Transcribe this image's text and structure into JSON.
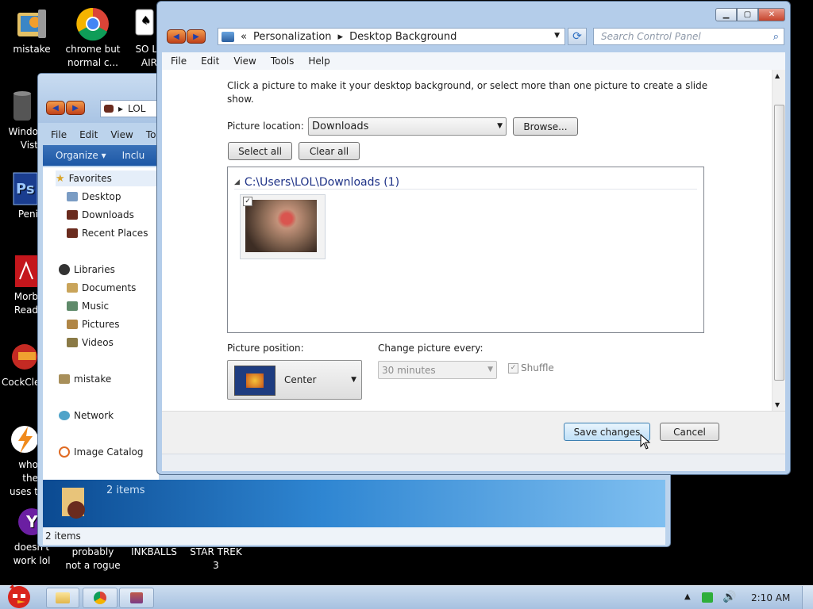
{
  "desktop_icons": [
    {
      "label": "mistake",
      "icon": "flower-folder-icon"
    },
    {
      "label": "chrome but normal c...",
      "icon": "chrome-icon"
    },
    {
      "label": "SO L AIR",
      "icon": "solitaire-icon"
    },
    {
      "label": "Windo Vist",
      "icon": "recycle-bin-icon"
    },
    {
      "label": "Peni",
      "icon": "photoshop-icon"
    },
    {
      "label": "Morb Read",
      "icon": "pdf-reader-icon"
    },
    {
      "label": "CockCle",
      "icon": "ccleaner-icon"
    },
    {
      "label": "who the uses t",
      "icon": "winamp-icon"
    },
    {
      "label": "doesn't work lol",
      "icon": "yahoo-icon"
    },
    {
      "label": "probably not a rogue",
      "icon": "blank-icon"
    },
    {
      "label": "INKBALLS",
      "icon": "blank-icon"
    },
    {
      "label": "STAR TREK 3",
      "icon": "blank-icon"
    }
  ],
  "explorer": {
    "breadcrumb": "LOL",
    "menu": [
      "File",
      "Edit",
      "View",
      "To"
    ],
    "toolbar": {
      "organize": "Organize ▾",
      "include": "Inclu"
    },
    "nav": {
      "favorites": "Favorites",
      "desktop": "Desktop",
      "downloads": "Downloads",
      "recent": "Recent Places",
      "libraries": "Libraries",
      "documents": "Documents",
      "music": "Music",
      "pictures": "Pictures",
      "videos": "Videos",
      "homegroup": "mistake",
      "network": "Network",
      "catalog": "Image Catalog"
    },
    "detail_count": "2 items",
    "status": "2 items"
  },
  "cpanel": {
    "address": {
      "sep": "«",
      "crumb1": "Personalization",
      "arrow": "▸",
      "crumb2": "Desktop Background"
    },
    "search_placeholder": "Search Control Panel",
    "menu": [
      "File",
      "Edit",
      "View",
      "Tools",
      "Help"
    ],
    "instructions": "Click a picture to make it your desktop background, or select more than one picture to create a slide show.",
    "picture_location_label": "Picture location:",
    "picture_location_value": "Downloads",
    "browse_label": "Browse...",
    "select_all_label": "Select all",
    "clear_all_label": "Clear all",
    "group_header": "C:\\Users\\LOL\\Downloads (1)",
    "picture_position_label": "Picture position:",
    "picture_position_value": "Center",
    "change_every_label": "Change picture every:",
    "change_every_value": "30 minutes",
    "shuffle_label": "Shuffle",
    "save_label": "Save changes",
    "cancel_label": "Cancel"
  },
  "taskbar": {
    "clock": "2:10 AM"
  },
  "colors": {
    "accent": "#2f6fc2",
    "taskbar": "#b9cfe8",
    "close": "#c6442c"
  }
}
